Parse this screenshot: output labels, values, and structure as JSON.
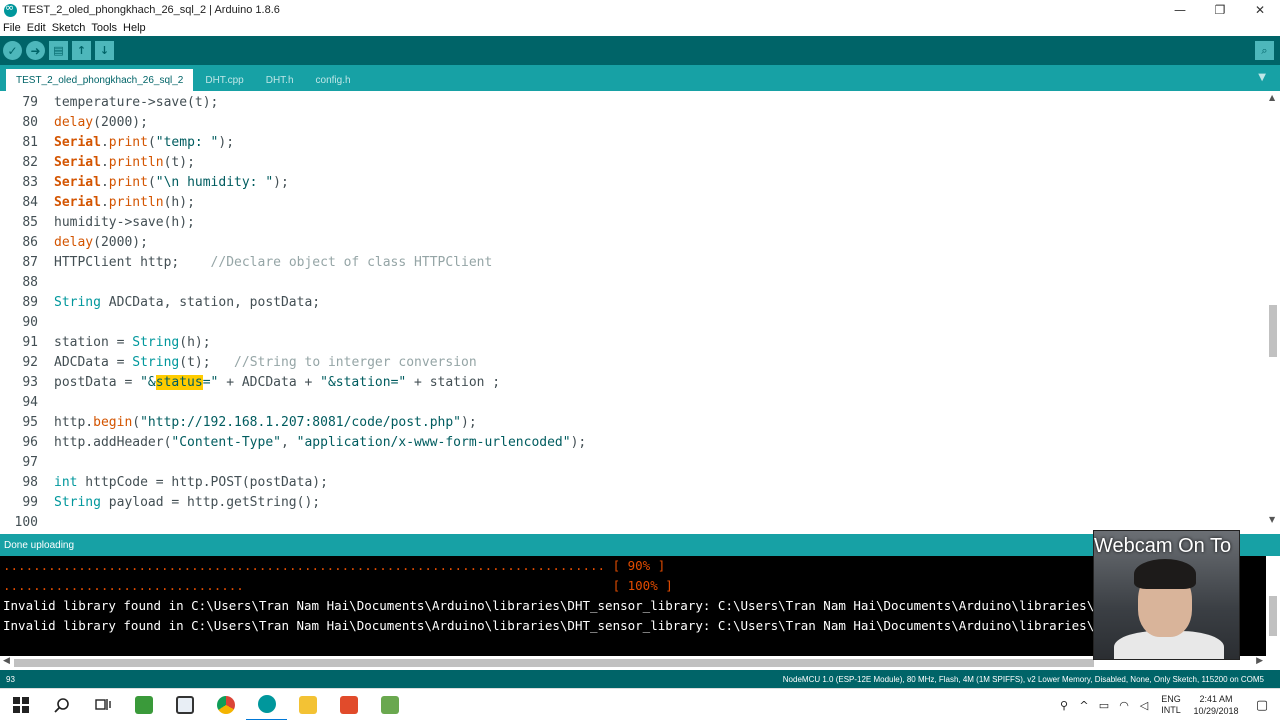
{
  "window": {
    "title": "TEST_2_oled_phongkhach_26_sql_2 | Arduino 1.8.6",
    "minimize_glyph": "—",
    "restore_glyph": "❐",
    "close_glyph": "✕"
  },
  "menu": [
    "File",
    "Edit",
    "Sketch",
    "Tools",
    "Help"
  ],
  "toolbar": {
    "verify_glyph": "✓",
    "upload_glyph": "➜",
    "new_glyph": "▤",
    "open_glyph": "↑",
    "save_glyph": "↓",
    "serial_glyph": "⌕",
    "icons": [
      "check-icon",
      "arrow-right-icon",
      "new-file-icon",
      "open-icon",
      "save-icon",
      "serial-monitor-icon"
    ]
  },
  "tabs": [
    {
      "label": "TEST_2_oled_phongkhach_26_sql_2",
      "active": true
    },
    {
      "label": "DHT.cpp",
      "active": false
    },
    {
      "label": "DHT.h",
      "active": false
    },
    {
      "label": "config.h",
      "active": false
    }
  ],
  "tab_menu_glyph": "▼",
  "editor": {
    "lines": [
      {
        "n": "79",
        "segs": [
          [
            "p",
            "temperature->save(t);"
          ]
        ]
      },
      {
        "n": "80",
        "segs": [
          [
            "k",
            "delay"
          ],
          [
            "p",
            "(2000);"
          ]
        ]
      },
      {
        "n": "81",
        "segs": [
          [
            "kb",
            "Serial"
          ],
          [
            "p",
            "."
          ],
          [
            "k",
            "print"
          ],
          [
            "p",
            "("
          ],
          [
            "s",
            "\"temp: \""
          ],
          [
            "p",
            ");"
          ]
        ]
      },
      {
        "n": "82",
        "segs": [
          [
            "kb",
            "Serial"
          ],
          [
            "p",
            "."
          ],
          [
            "k",
            "println"
          ],
          [
            "p",
            "(t);"
          ]
        ]
      },
      {
        "n": "83",
        "segs": [
          [
            "kb",
            "Serial"
          ],
          [
            "p",
            "."
          ],
          [
            "k",
            "print"
          ],
          [
            "p",
            "("
          ],
          [
            "s",
            "\"\\n humidity: \""
          ],
          [
            "p",
            ");"
          ]
        ]
      },
      {
        "n": "84",
        "segs": [
          [
            "kb",
            "Serial"
          ],
          [
            "p",
            "."
          ],
          [
            "k",
            "println"
          ],
          [
            "p",
            "(h);"
          ]
        ]
      },
      {
        "n": "85",
        "segs": [
          [
            "p",
            "humidity->save(h);"
          ]
        ]
      },
      {
        "n": "86",
        "segs": [
          [
            "k",
            "delay"
          ],
          [
            "p",
            "(2000);"
          ]
        ]
      },
      {
        "n": "87",
        "segs": [
          [
            "p",
            "HTTPClient http;    "
          ],
          [
            "c",
            "//Declare object of class HTTPClient"
          ]
        ]
      },
      {
        "n": "88",
        "segs": []
      },
      {
        "n": "89",
        "segs": [
          [
            "t",
            "String"
          ],
          [
            "p",
            " ADCData, station, postData;"
          ]
        ]
      },
      {
        "n": "90",
        "segs": []
      },
      {
        "n": "91",
        "segs": [
          [
            "p",
            "station = "
          ],
          [
            "t",
            "String"
          ],
          [
            "p",
            "(h);"
          ]
        ]
      },
      {
        "n": "92",
        "segs": [
          [
            "p",
            "ADCData = "
          ],
          [
            "t",
            "String"
          ],
          [
            "p",
            "(t);   "
          ],
          [
            "c",
            "//String to interger conversion"
          ]
        ]
      },
      {
        "n": "93",
        "segs": [
          [
            "p",
            "postData = "
          ],
          [
            "s",
            "\"&"
          ],
          [
            "h",
            "status"
          ],
          [
            "s",
            "=\""
          ],
          [
            "p",
            " + ADCData + "
          ],
          [
            "s",
            "\"&station=\""
          ],
          [
            "p",
            " + station ;"
          ]
        ]
      },
      {
        "n": "94",
        "segs": []
      },
      {
        "n": "95",
        "segs": [
          [
            "p",
            "http."
          ],
          [
            "k",
            "begin"
          ],
          [
            "p",
            "("
          ],
          [
            "s",
            "\"http://192.168.1.207:8081/code/post.php\""
          ],
          [
            "p",
            ");"
          ]
        ]
      },
      {
        "n": "96",
        "segs": [
          [
            "p",
            "http.addHeader("
          ],
          [
            "s",
            "\"Content-Type\""
          ],
          [
            "p",
            ", "
          ],
          [
            "s",
            "\"application/x-www-form-urlencoded\""
          ],
          [
            "p",
            ");"
          ]
        ]
      },
      {
        "n": "97",
        "segs": []
      },
      {
        "n": "98",
        "segs": [
          [
            "t",
            "int"
          ],
          [
            "p",
            " httpCode = http.POST(postData);"
          ]
        ]
      },
      {
        "n": "99",
        "segs": [
          [
            "t",
            "String"
          ],
          [
            "p",
            " payload = http.getString();"
          ]
        ]
      },
      {
        "n": "100",
        "segs": []
      }
    ]
  },
  "status": {
    "message": "Done uploading"
  },
  "console": {
    "progress_90_dots": "................................................................................ [ 90% ]",
    "progress_100_dots": "................................                                                 [ 100% ]",
    "error_1": "Invalid library found in C:\\Users\\Tran Nam Hai\\Documents\\Arduino\\libraries\\DHT_sensor_library: C:\\Users\\Tran Nam Hai\\Documents\\Arduino\\libraries\\D",
    "error_2": "Invalid library found in C:\\Users\\Tran Nam Hai\\Documents\\Arduino\\libraries\\DHT_sensor_library: C:\\Users\\Tran Nam Hai\\Documents\\Arduino\\libraries\\D"
  },
  "bottom": {
    "line_number": "93",
    "board": "NodeMCU 1.0 (ESP-12E Module), 80 MHz, Flash, 4M (1M SPIFFS), v2 Lower Memory, Disabled, None, Only Sketch, 115200 on COM5"
  },
  "webcam": {
    "overlay_text": "Webcam On To"
  },
  "taskbar": {
    "lang_1": "ENG",
    "lang_2": "INTL",
    "time": "2:41 AM",
    "date": "10/29/2018",
    "apps": [
      "start-icon",
      "search-icon",
      "task-view-icon",
      "app-green-icon",
      "store-icon",
      "chrome-icon",
      "arduino-icon",
      "file-explorer-icon",
      "app-red-icon",
      "app-notepad-icon"
    ],
    "colors": {
      "accent": "#0078d7"
    }
  },
  "colors": {
    "toolbar": "#006468",
    "tabbar": "#17a1a5",
    "keyword": "#d35400",
    "type": "#00979c",
    "string": "#005c5f",
    "comment": "#95a5a6",
    "highlight": "#ffcc00"
  }
}
